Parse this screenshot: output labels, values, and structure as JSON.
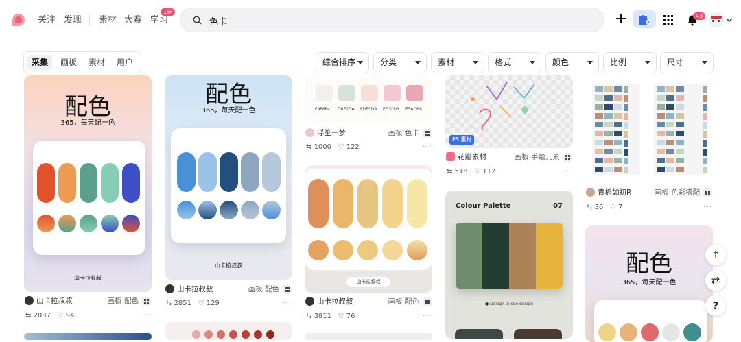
{
  "nav": {
    "items": [
      "关注",
      "发现",
      "素材",
      "大赛",
      "学习"
    ],
    "learn_badge": "1元"
  },
  "search": {
    "value": "色卡"
  },
  "header": {
    "notification_count": "43"
  },
  "tabs": {
    "items": [
      "采集",
      "画板",
      "素材",
      "用户"
    ],
    "active": "采集"
  },
  "filters": [
    "综合排序",
    "分类",
    "素材",
    "格式",
    "颜色",
    "比例",
    "尺寸"
  ],
  "cards": {
    "c1": {
      "title": "配色",
      "subtitle": "365，每天配一色",
      "sig": "山卡拉叔叔",
      "user": "山卡拉叔叔",
      "board_label": "画板",
      "board": "配色",
      "saves": "2037",
      "likes": "94"
    },
    "c2": {
      "title": "配色",
      "subtitle": "365，每天配一色",
      "sig": "山卡拉叔叔",
      "user": "山卡拉叔叔",
      "board_label": "画板",
      "board": "配色",
      "saves": "2851",
      "likes": "129"
    },
    "c3": {
      "codes": [
        "F9F8F4",
        "D8E2DA",
        "FDE5D9",
        "FFCCD3",
        "F5ADB8"
      ],
      "user": "浮笙一梦",
      "board_label": "画板",
      "board": "色卡",
      "saves": "1000",
      "likes": "122"
    },
    "c4": {
      "sig": "山卡拉叔叔",
      "user": "山卡拉叔叔",
      "board_label": "画板",
      "board": "配色",
      "saves": "3811",
      "likes": "76"
    },
    "c5": {
      "ps_badge": "素材",
      "user": "花瓣素材",
      "board_label": "画板",
      "board": "手绘元素",
      "saves": "518",
      "likes": "112"
    },
    "c6": {
      "title": "Colour Palette",
      "number": "07",
      "codes": [
        "",
        "",
        "",
        ""
      ],
      "footer": "Design to see design"
    },
    "c7": {
      "user": "青栀如初R",
      "board_label": "画板",
      "board": "色彩搭配",
      "saves": "36",
      "likes": "7"
    },
    "c8": {
      "title": "配色",
      "subtitle": "365，每天配一色"
    }
  },
  "fab": {
    "up": "↑",
    "filter": "⇄",
    "help": "?"
  },
  "colors": {
    "accent": "#f0506e",
    "page_bg": "#ffffff",
    "search_bg": "#f2f2f4"
  }
}
